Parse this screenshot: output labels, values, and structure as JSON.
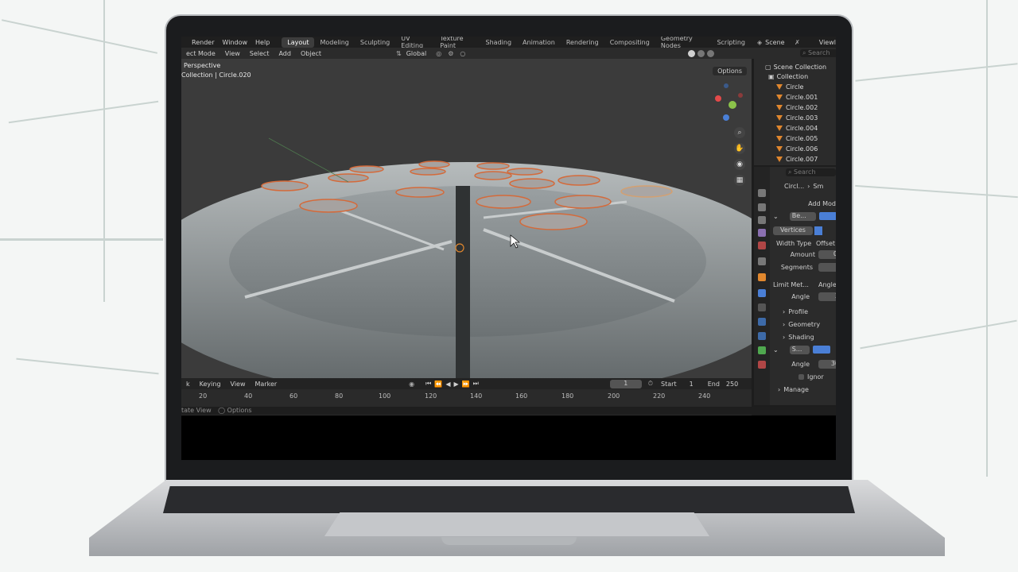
{
  "topbar": {
    "menus": [
      "Render",
      "Window",
      "Help"
    ],
    "workspaces": [
      "Layout",
      "Modeling",
      "Sculpting",
      "UV Editing",
      "Texture Paint",
      "Shading",
      "Animation",
      "Rendering",
      "Compositing",
      "Geometry Nodes",
      "Scripting"
    ],
    "scene": "Scene",
    "view_layer": "Viewl"
  },
  "viewport_header": {
    "mode": "ect Mode",
    "menus": [
      "View",
      "Select",
      "Add",
      "Object"
    ],
    "orientation": "Global",
    "options": "Options"
  },
  "viewport": {
    "view_name": "Perspective",
    "object_path": "Collection | Circle.020"
  },
  "outliner": {
    "search_placeholder": "Search",
    "scene_collection": "Scene Collection",
    "collection": "Collection",
    "objects": [
      "Circle",
      "Circle.001",
      "Circle.002",
      "Circle.003",
      "Circle.004",
      "Circle.005",
      "Circle.006",
      "Circle.007"
    ]
  },
  "properties": {
    "search_placeholder": "Search",
    "breadcrumb": [
      "Circl...",
      "Sm"
    ],
    "add_modifier": "Add Mod",
    "bevel_name": "Be...",
    "affect": "Vertices",
    "width_type_label": "Width Type",
    "width_type_value": "Offset",
    "amount_label": "Amount",
    "amount_value": "0",
    "segments_label": "Segments",
    "limit_method_label": "Limit Met...",
    "limit_method_value": "Angle",
    "angle_label": "Angle",
    "angle_value": "3",
    "panels": [
      "Profile",
      "Geometry",
      "Shading"
    ],
    "smooth_name": "S...",
    "smooth_angle_label": "Angle",
    "smooth_angle_value": "30",
    "ignore_label": "Ignor",
    "manage": "Manage"
  },
  "timeline": {
    "menus": [
      "k",
      "Keying",
      "View",
      "Marker"
    ],
    "current_frame": "1",
    "start_label": "Start",
    "start_value": "1",
    "end_label": "End",
    "end_value": "250",
    "frame_numbers": [
      "20",
      "40",
      "60",
      "80",
      "100",
      "120",
      "140",
      "160",
      "180",
      "200",
      "220",
      "240"
    ]
  },
  "statusbar": {
    "left": "tate View",
    "options": "Options"
  },
  "colors": {
    "accent_orange": "#e0872e",
    "active_blue": "#4a7fd6",
    "viewport_bg": "#3a3a3a"
  }
}
